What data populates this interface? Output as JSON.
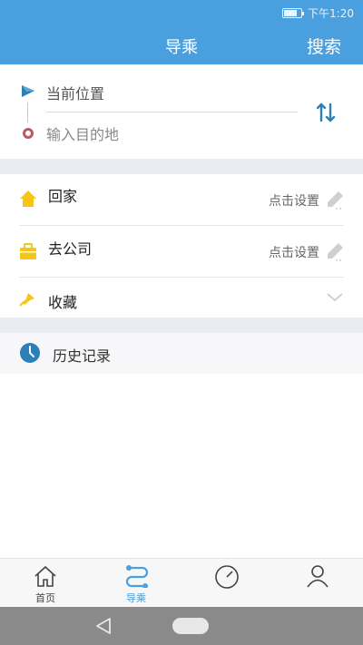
{
  "status": {
    "time": "下午1:20",
    "battery_level": 0.75,
    "battery_icon": "battery-icon"
  },
  "header": {
    "title": "导乘",
    "search_label": "搜索",
    "color": "#4a9fde"
  },
  "route": {
    "origin_label": "当前位置",
    "destination_placeholder": "输入目的地",
    "origin_icon": "navigation-arrow-icon",
    "destination_icon": "destination-ring-icon",
    "swap_icon": "swap-vertical-icon"
  },
  "shortcuts": [
    {
      "label": "回家",
      "hint": "点击设置",
      "icon": "home-icon",
      "action_icon": "pencil-icon"
    },
    {
      "label": "去公司",
      "hint": "点击设置",
      "icon": "briefcase-icon",
      "action_icon": "pencil-icon"
    },
    {
      "label": "收藏",
      "hint": "",
      "icon": "pin-icon",
      "action_icon": "chevron-down-icon"
    }
  ],
  "history": {
    "label": "历史记录",
    "icon": "clock-icon"
  },
  "tabs": [
    {
      "label": "首页",
      "icon": "house-icon",
      "active": false
    },
    {
      "label": "导乘",
      "icon": "route-icon",
      "active": true
    },
    {
      "label": "",
      "icon": "gauge-icon",
      "active": false
    },
    {
      "label": "",
      "icon": "person-icon",
      "active": false
    }
  ],
  "system_nav": {
    "back_icon": "back-triangle-icon",
    "home_icon": "home-pill-icon"
  },
  "colors": {
    "accent": "#4a9fde",
    "band": "#ebebf3",
    "icon_yellow": "#f5c518",
    "destination_red": "#c0585c"
  }
}
